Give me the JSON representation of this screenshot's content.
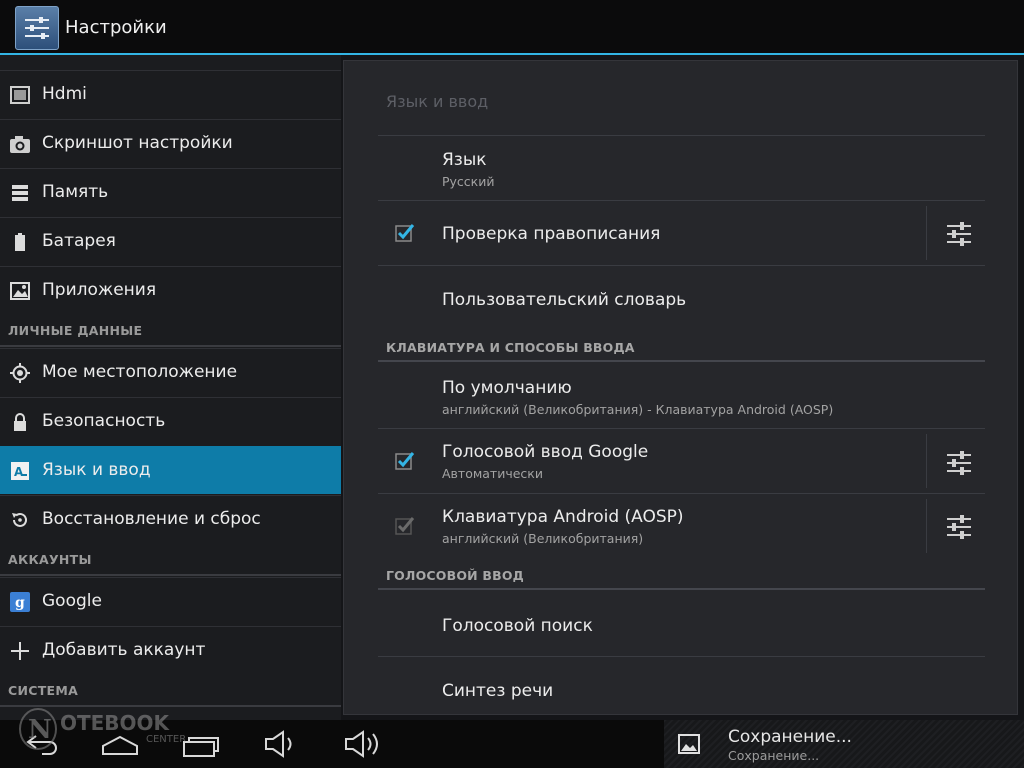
{
  "action_bar": {
    "title": "Настройки"
  },
  "sidebar": {
    "items": [
      {
        "label": "Hdmi",
        "icon": "hdmi-icon"
      },
      {
        "label": "Скриншот настройки",
        "icon": "camera-icon"
      },
      {
        "label": "Память",
        "icon": "storage-icon"
      },
      {
        "label": "Батарея",
        "icon": "battery-icon"
      },
      {
        "label": "Приложения",
        "icon": "apps-icon"
      },
      {
        "label": "Мое местоположение",
        "icon": "location-icon"
      },
      {
        "label": "Безопасность",
        "icon": "lock-icon"
      },
      {
        "label": "Язык и ввод",
        "icon": "language-icon",
        "selected": true
      },
      {
        "label": "Восстановление и сброс",
        "icon": "restore-icon"
      },
      {
        "label": "Google",
        "icon": "google-icon"
      },
      {
        "label": "Добавить аккаунт",
        "icon": "plus-icon"
      }
    ],
    "headers": {
      "personal": "ЛИЧНЫЕ ДАННЫЕ",
      "accounts": "АККАУНТЫ",
      "system": "СИСТЕМА"
    }
  },
  "main": {
    "title": "Язык и ввод",
    "language": {
      "label": "Язык",
      "value": "Русский"
    },
    "spellcheck": {
      "label": "Проверка правописания",
      "checked": true
    },
    "user_dictionary": {
      "label": "Пользовательский словарь"
    },
    "keyboard_section": "КЛАВИАТУРА И СПОСОБЫ ВВОДА",
    "default": {
      "label": "По умолчанию",
      "value": "английский (Великобритания) - Клавиатура Android (AOSP)"
    },
    "google_voice": {
      "label": "Голосовой ввод Google",
      "value": "Автоматически",
      "checked": true
    },
    "aosp_keyboard": {
      "label": "Клавиатура Android (AOSP)",
      "value": "английский (Великобритания)",
      "checked": true,
      "disabled": true
    },
    "voice_section": "ГОЛОСОВОЙ ВВОД",
    "voice_search": {
      "label": "Голосовой поиск"
    },
    "tts": {
      "label": "Синтез речи"
    }
  },
  "navbar": {
    "buttons": [
      "back-icon",
      "home-icon",
      "recent-apps-icon",
      "volume-down-icon",
      "volume-up-icon"
    ]
  },
  "notification": {
    "title": "Сохранение...",
    "subtitle": "Сохранение..."
  },
  "watermark": {
    "text": "NOTEBOOK",
    "subtext": "CENTER"
  },
  "colors": {
    "accent": "#33b5e5",
    "selected": "#0e7ca8",
    "panel": "#26272b"
  }
}
